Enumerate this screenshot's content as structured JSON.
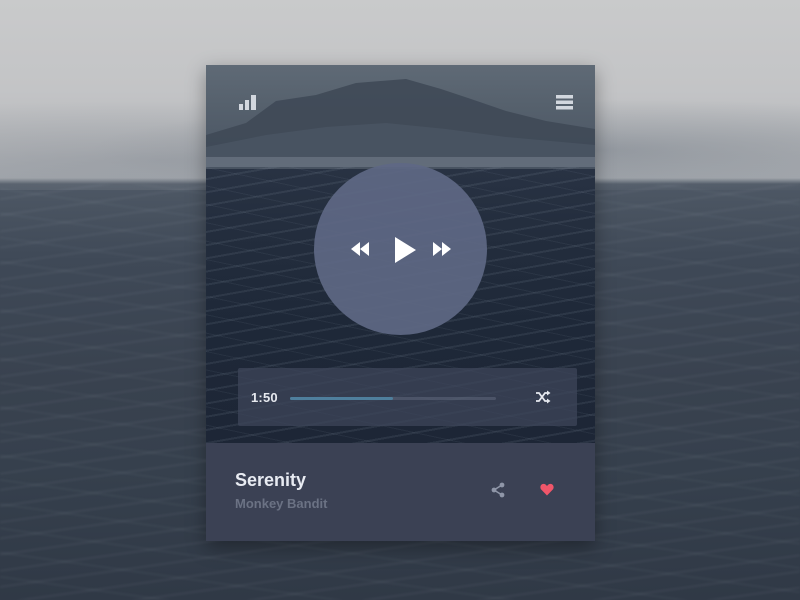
{
  "player": {
    "elapsed_time": "1:50",
    "progress_fraction": 0.5,
    "track": {
      "title": "Serenity",
      "artist": "Monkey Bandit"
    },
    "liked": true
  },
  "icons": {
    "top_left": "signal-bars-icon",
    "top_right": "hamburger-menu-icon",
    "rewind": "rewind-icon",
    "play": "play-icon",
    "forward": "fast-forward-icon",
    "shuffle": "shuffle-icon",
    "share": "share-icon",
    "like": "heart-icon"
  },
  "colors": {
    "heart": "#f0566a",
    "progress": "#4f7f9d",
    "info_bg": "#3b4154",
    "control_circle": "#5e6884"
  }
}
